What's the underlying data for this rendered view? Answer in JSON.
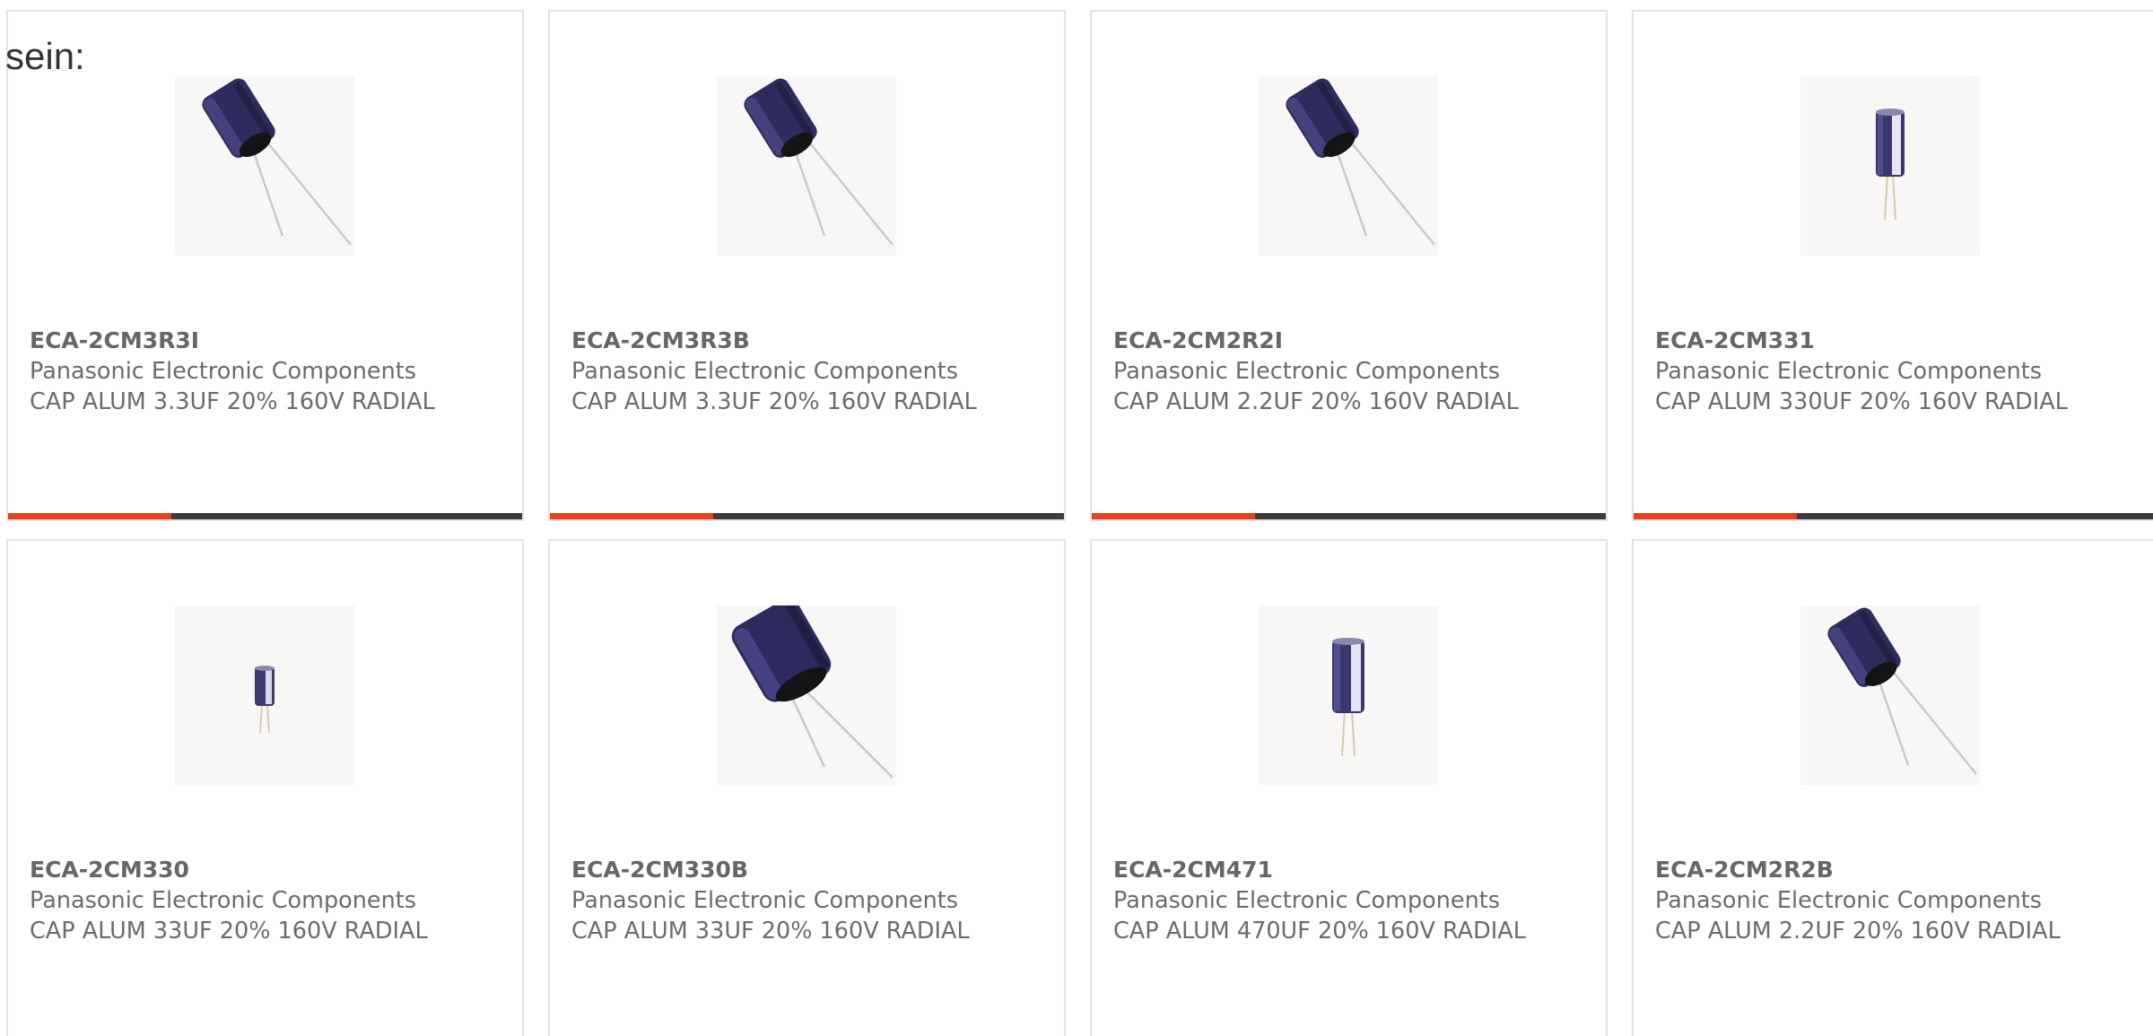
{
  "intro_text": "sein:",
  "accent_color": "#e8401c",
  "bar_color": "#3c3c3c",
  "products": [
    {
      "part_number": "ECA-2CM3R3I",
      "manufacturer": "Panasonic Electronic Components",
      "description": "CAP ALUM 3.3UF 20% 160V RADIAL",
      "image_icon": "capacitor-angled-icon"
    },
    {
      "part_number": "ECA-2CM3R3B",
      "manufacturer": "Panasonic Electronic Components",
      "description": "CAP ALUM 3.3UF 20% 160V RADIAL",
      "image_icon": "capacitor-angled-icon"
    },
    {
      "part_number": "ECA-2CM2R2I",
      "manufacturer": "Panasonic Electronic Components",
      "description": "CAP ALUM 2.2UF 20% 160V RADIAL",
      "image_icon": "capacitor-angled-icon"
    },
    {
      "part_number": "ECA-2CM331",
      "manufacturer": "Panasonic Electronic Components",
      "description": "CAP ALUM 330UF 20% 160V RADIAL",
      "image_icon": "capacitor-upright-icon"
    },
    {
      "part_number": "ECA-2CM330",
      "manufacturer": "Panasonic Electronic Components",
      "description": "CAP ALUM 33UF 20% 160V RADIAL",
      "image_icon": "capacitor-upright-small-icon"
    },
    {
      "part_number": "ECA-2CM330B",
      "manufacturer": "Panasonic Electronic Components",
      "description": "CAP ALUM 33UF 20% 160V RADIAL",
      "image_icon": "capacitor-angled-large-icon"
    },
    {
      "part_number": "ECA-2CM471",
      "manufacturer": "Panasonic Electronic Components",
      "description": "CAP ALUM 470UF 20% 160V RADIAL",
      "image_icon": "capacitor-upright-icon"
    },
    {
      "part_number": "ECA-2CM2R2B",
      "manufacturer": "Panasonic Electronic Components",
      "description": "CAP ALUM 2.2UF 20% 160V RADIAL",
      "image_icon": "capacitor-angled-icon"
    }
  ]
}
